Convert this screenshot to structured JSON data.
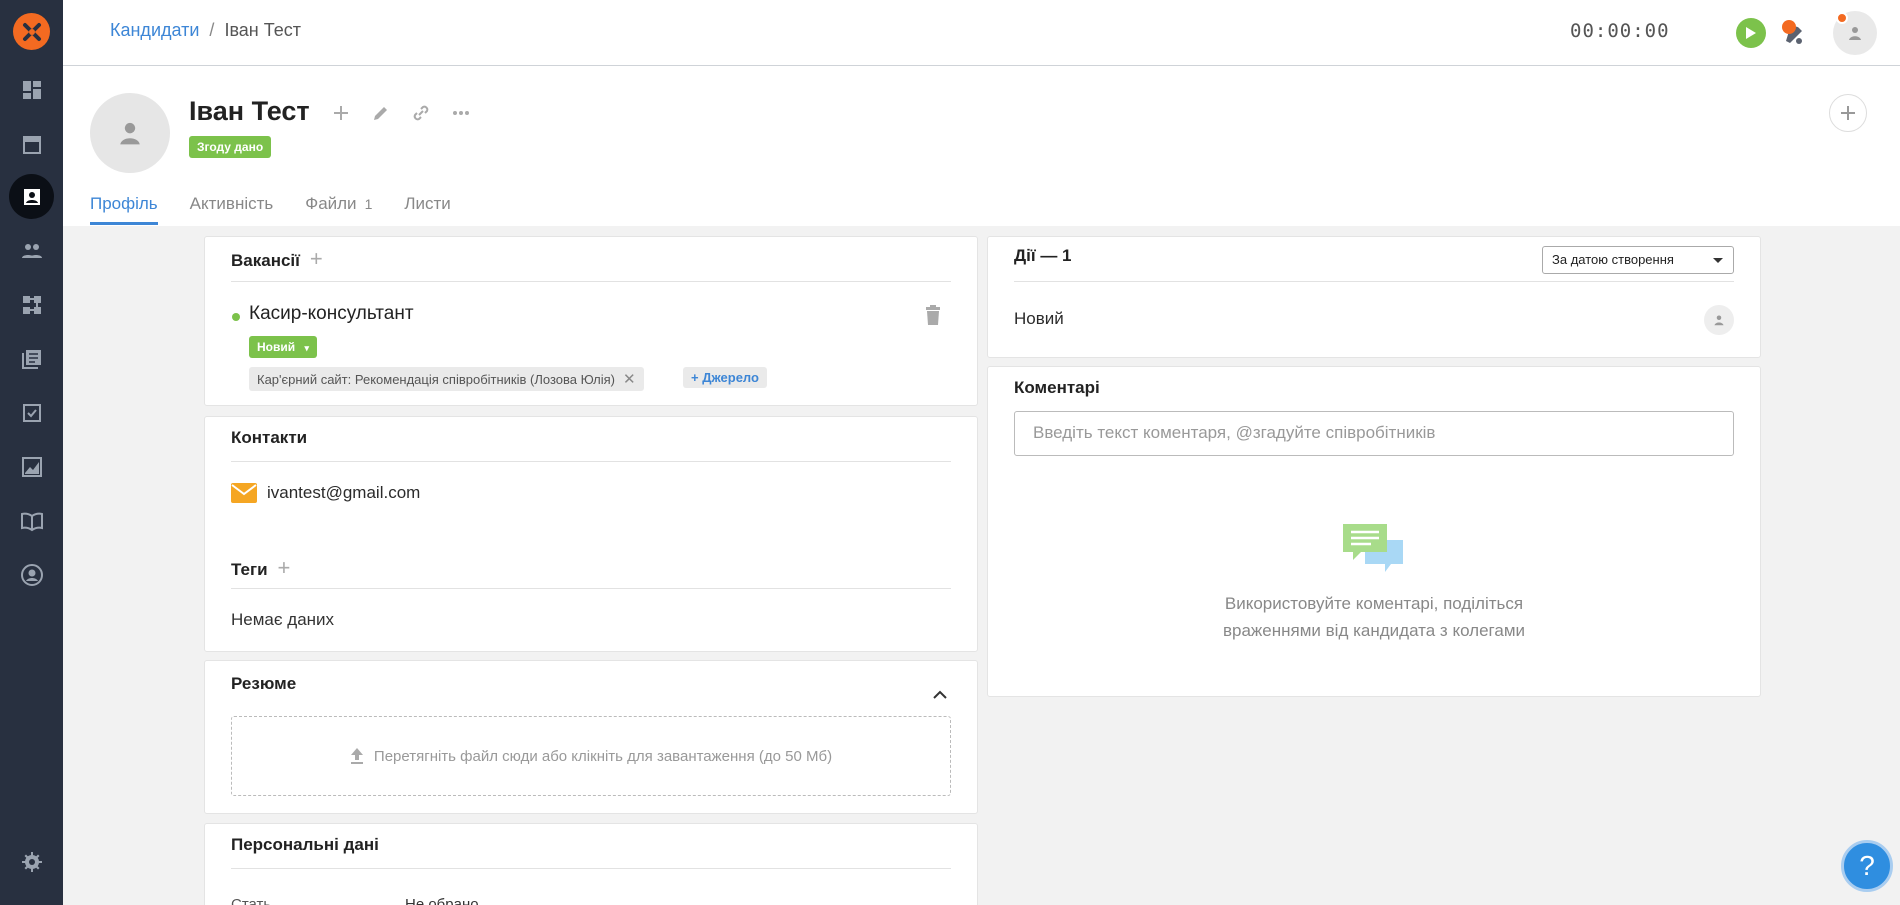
{
  "header": {
    "breadcrumb_root": "Кандидати",
    "breadcrumb_sep": "/",
    "breadcrumb_current": "Іван Тест",
    "timer": "00:00:00"
  },
  "sidebar": {
    "items": [
      {
        "icon": "dashboard-icon"
      },
      {
        "icon": "calendar-icon"
      },
      {
        "icon": "candidates-icon",
        "active": true
      },
      {
        "icon": "team-icon"
      },
      {
        "icon": "pipeline-icon"
      },
      {
        "icon": "library-icon"
      },
      {
        "icon": "tasks-icon"
      },
      {
        "icon": "analytics-icon"
      },
      {
        "icon": "knowledge-base-icon"
      },
      {
        "icon": "account-icon"
      },
      {
        "icon": "settings-icon"
      }
    ]
  },
  "profile": {
    "name": "Іван Тест",
    "consent_badge": "Згоду дано",
    "tabs": [
      {
        "label": "Профіль",
        "active": true
      },
      {
        "label": "Активність"
      },
      {
        "label": "Файли",
        "count": "1"
      },
      {
        "label": "Листи"
      }
    ]
  },
  "vacancies": {
    "title": "Вакансії",
    "item_name": "Касир-консультант",
    "status": "Новий",
    "source": "Кар'єрний сайт: Рекомендація співробітників (Лозова Юлія)",
    "add_source": "Джерело"
  },
  "contacts": {
    "title": "Контакти",
    "email": "ivantest@gmail.com"
  },
  "tags": {
    "title": "Теги",
    "empty": "Немає даних"
  },
  "resume": {
    "title": "Резюме",
    "upload_text": "Перетягніть файл сюди або клікніть для завантаження (до 50 Мб)"
  },
  "personal": {
    "title": "Персональні дані",
    "row_label": "Стать",
    "row_value": "Не обрано"
  },
  "actions": {
    "title": "Дії — 1",
    "sort_label": "За датою створення",
    "item": "Новий"
  },
  "comments": {
    "title": "Коментарі",
    "placeholder": "Введіть текст коментаря, @згадуйте співробітників",
    "empty_line1": "Використовуйте коментарі, поділіться",
    "empty_line2": "враженнями від кандидата з колегами"
  },
  "help": {
    "label": "?"
  },
  "colors": {
    "brand_orange": "#f36a21",
    "sidebar_bg": "#283040",
    "accent_blue": "#3d86d6",
    "status_green": "#7cc24b"
  }
}
